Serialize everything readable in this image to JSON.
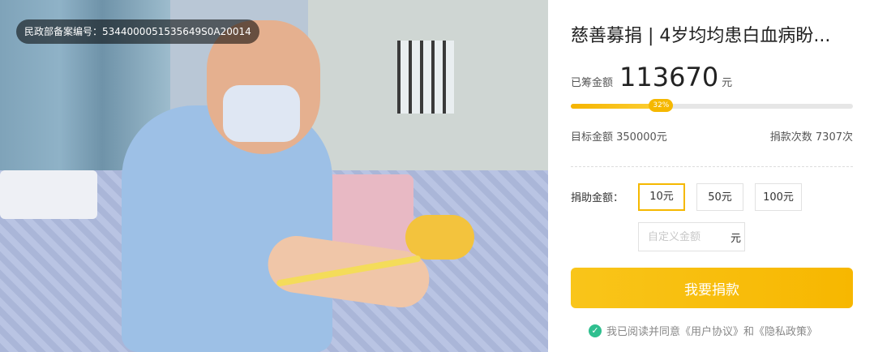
{
  "badge": {
    "text": "民政部备案编号：5344000051535649S0A20014"
  },
  "campaign": {
    "title": "慈善募捐 | 4岁均均患白血病盼...",
    "raised_label": "已筹金额",
    "raised_amount": "113670",
    "raised_unit": "元",
    "progress_label": "32%",
    "progress_fraction": 0.32,
    "target_text": "目标金额 350000元",
    "donations_text": "捐款次数 7307次"
  },
  "donate": {
    "label": "捐助金额：",
    "options": [
      "10元",
      "50元",
      "100元"
    ],
    "selected_index": 0,
    "custom_placeholder": "自定义金额",
    "custom_unit": "元",
    "button_label": "我要捐款"
  },
  "agreement": {
    "icon": "check-circle-icon",
    "text": "我已阅读并同意《用户协议》和《隐私政策》"
  },
  "colors": {
    "accent": "#f5b800",
    "check": "#2fbf8f"
  }
}
